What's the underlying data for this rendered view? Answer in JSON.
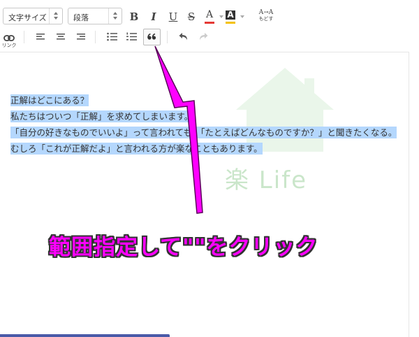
{
  "toolbar": {
    "font_size_select": "文字サイズ",
    "paragraph_select": "段落",
    "bold": "B",
    "italic": "I",
    "underline": "U",
    "strike": "S",
    "text_color": "A",
    "bg_color": "A",
    "clear_format_top": "A→A",
    "clear_format_bottom": "もどす",
    "link_label": "リンク"
  },
  "colors": {
    "text_color_bar": "#e53935",
    "bg_color_bar": "#f4c20d",
    "highlight": "#b4d7fd",
    "annotation": "#ff00ff"
  },
  "editor": {
    "lines": [
      "正解はどこにある？",
      "私たちはついつ「正解」を求めてしまいます。",
      "「自分の好きなものでいいよ」って言われても、「たとえばどんなものですか？」と聞きたくなる。",
      "むしろ「これが正解だよ」と言われる方が楽なこともあります。"
    ]
  },
  "watermark": {
    "text": "楽 Life"
  },
  "annotation": {
    "caption": "範囲指定して\"\"をクリック"
  }
}
